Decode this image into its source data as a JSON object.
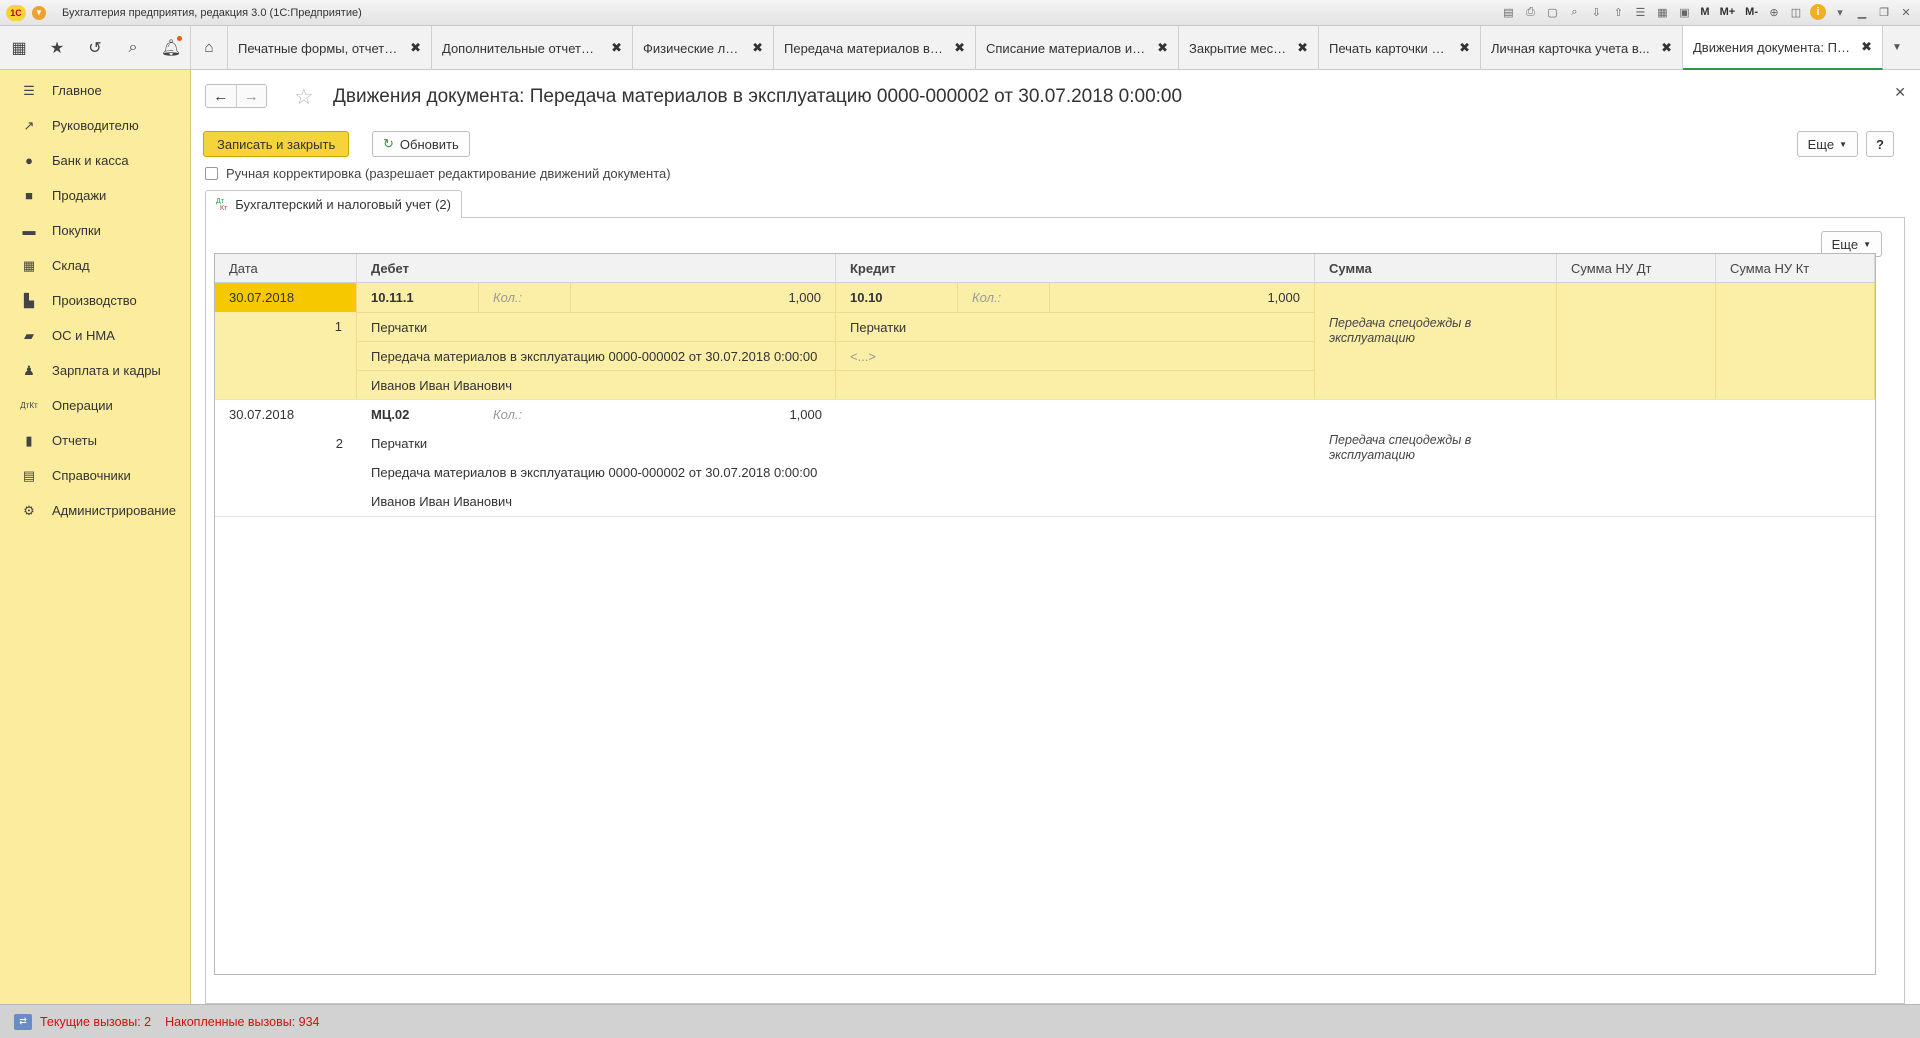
{
  "app": {
    "window_title": "Бухгалтерия предприятия, редакция 3.0  (1С:Предприятие)",
    "logo": "1С",
    "title_tools": [
      "M",
      "M+",
      "M-"
    ]
  },
  "tabs": [
    {
      "label": "Печатные формы, отчеты ...",
      "close": "✖"
    },
    {
      "label": "Дополнительные отчеты и...",
      "close": "✖"
    },
    {
      "label": "Физические лица",
      "close": "✖"
    },
    {
      "label": "Передача материалов в э...",
      "close": "✖"
    },
    {
      "label": "Списание материалов из ...",
      "close": "✖"
    },
    {
      "label": "Закрытие месяца",
      "close": "✖"
    },
    {
      "label": "Печать карточки СИЗ",
      "close": "✖"
    },
    {
      "label": "Личная карточка учета в...",
      "close": "✖"
    },
    {
      "label": "Движения документа: Пе...",
      "close": "✖"
    }
  ],
  "sidebar": {
    "items": [
      {
        "label": "Главное",
        "icon": "menu-icon"
      },
      {
        "label": "Руководителю",
        "icon": "chart-line-icon"
      },
      {
        "label": "Банк и касса",
        "icon": "coin-icon"
      },
      {
        "label": "Продажи",
        "icon": "shopping-bag-icon"
      },
      {
        "label": "Покупки",
        "icon": "cart-icon"
      },
      {
        "label": "Склад",
        "icon": "warehouse-icon"
      },
      {
        "label": "Производство",
        "icon": "factory-icon"
      },
      {
        "label": "ОС и НМА",
        "icon": "truck-icon"
      },
      {
        "label": "Зарплата и кадры",
        "icon": "person-icon"
      },
      {
        "label": "Операции",
        "icon": "dt-kt-icon"
      },
      {
        "label": "Отчеты",
        "icon": "bar-chart-icon"
      },
      {
        "label": "Справочники",
        "icon": "book-icon"
      },
      {
        "label": "Администрирование",
        "icon": "gear-icon"
      }
    ]
  },
  "form": {
    "title": "Движения документа: Передача материалов в эксплуатацию 0000-000002 от 30.07.2018 0:00:00",
    "save_close": "Записать и закрыть",
    "refresh": "Обновить",
    "more": "Еще",
    "help": "?",
    "manual_edit": "Ручная корректировка (разрешает редактирование движений документа)",
    "tab_label": "Бухгалтерский и налоговый учет (2)",
    "dt": "Дт",
    "kt": "Кт"
  },
  "grid": {
    "columns": [
      "Дата",
      "Дебет",
      "Кредит",
      "Сумма",
      "Сумма НУ Дт",
      "Сумма НУ Кт"
    ],
    "rows": [
      {
        "date": "30.07.2018",
        "number": "1",
        "debit": {
          "account": "10.11.1",
          "qty_label": "Кол.:",
          "qty": "1,000",
          "sub1": "Перчатки",
          "sub2": "Передача материалов в эксплуатацию 0000-000002 от 30.07.2018 0:00:00",
          "sub3": "Иванов Иван Иванович"
        },
        "credit": {
          "account": "10.10",
          "qty_label": "Кол.:",
          "qty": "1,000",
          "sub1": "Перчатки",
          "sub2": "<...>"
        },
        "sum": "",
        "content": "Передача спецодежды в эксплуатацию"
      },
      {
        "date": "30.07.2018",
        "number": "2",
        "debit": {
          "account": "МЦ.02",
          "qty_label": "Кол.:",
          "qty": "1,000",
          "sub1": "Перчатки",
          "sub2": "Передача материалов в эксплуатацию 0000-000002 от 30.07.2018 0:00:00",
          "sub3": "Иванов Иван Иванович"
        },
        "content": "Передача спецодежды в эксплуатацию"
      }
    ]
  },
  "status": {
    "current": "Текущие вызовы: 2",
    "accumulated": "Накопленные вызовы: 934"
  }
}
